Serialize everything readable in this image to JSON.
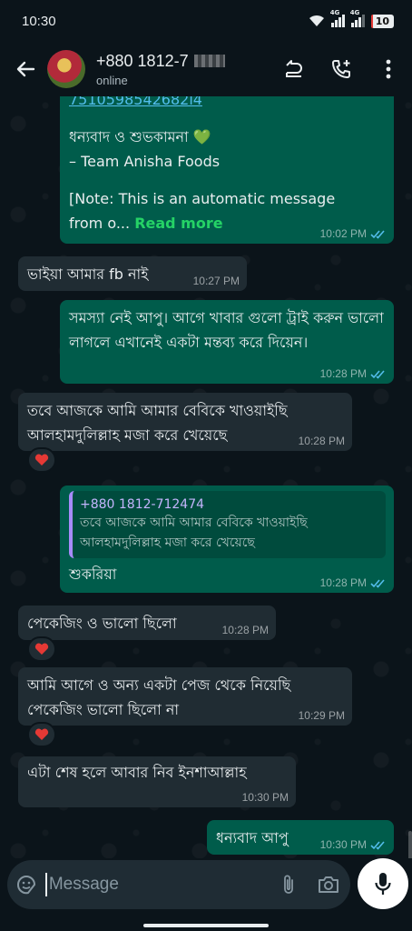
{
  "status_bar": {
    "time": "10:30",
    "network_1": "4G",
    "network_2": "4G",
    "battery": "10"
  },
  "header": {
    "contact_name": "+880 1812-7",
    "contact_status": "online"
  },
  "messages": [
    {
      "text_link": "7510598542682l4",
      "line1": "ধন্যবাদ ও শুভকামনা 💚",
      "line2": "– Team Anisha Foods",
      "line3": "[Note: This is an automatic message",
      "line4": "from o...",
      "read_more": "Read more",
      "time": "10:02 PM"
    },
    {
      "text": "ভাইয়া আমার fb নাই",
      "time": "10:27 PM"
    },
    {
      "text": "সমস্যা নেই আপু। আগে খাবার গুলো ট্রাই করুন ভালো লাগলে এখানেই একটা মন্তব্য করে দিয়েন।",
      "time": "10:28 PM"
    },
    {
      "text": "তবে আজকে আমি আমার বেবিকে খাওয়াইছি আলহামদুলিল্লাহ মজা করে খেয়েছে",
      "time": "10:28 PM",
      "reaction": "❤️"
    },
    {
      "quote_name": "+880 1812-712474",
      "quote_text": "তবে আজকে আমি আমার বেবিকে খাওয়াইছি আলহামদুলিল্লাহ মজা করে খেয়েছে",
      "text": "শুকরিয়া",
      "time": "10:28 PM"
    },
    {
      "text": "পেকেজিং ও ভালো ছিলো",
      "time": "10:28 PM",
      "reaction": "❤️"
    },
    {
      "text": "আমি আগে ও অন্য একটা পেজ থেকে নিয়েছি পেকেজিং ভালো ছিলো না",
      "time": "10:29 PM",
      "reaction": "❤️"
    },
    {
      "text": "এটা শেষ হলে আবার নিব ইনশাআল্লাহ",
      "time": "10:30 PM"
    },
    {
      "text": "ধন্যবাদ আপু",
      "time": "10:30 PM"
    }
  ],
  "composer": {
    "placeholder": "Message"
  },
  "colors": {
    "outgoing": "#005c4b",
    "incoming": "#202c33",
    "background": "#0b141a",
    "read_ticks": "#53bdeb",
    "accent": "#25d366"
  },
  "icons": [
    "back-arrow-icon",
    "call-forward-icon",
    "add-call-icon",
    "more-vertical-icon",
    "sticker-icon",
    "attach-icon",
    "camera-icon",
    "mic-icon",
    "double-check-icon",
    "heart-icon"
  ]
}
